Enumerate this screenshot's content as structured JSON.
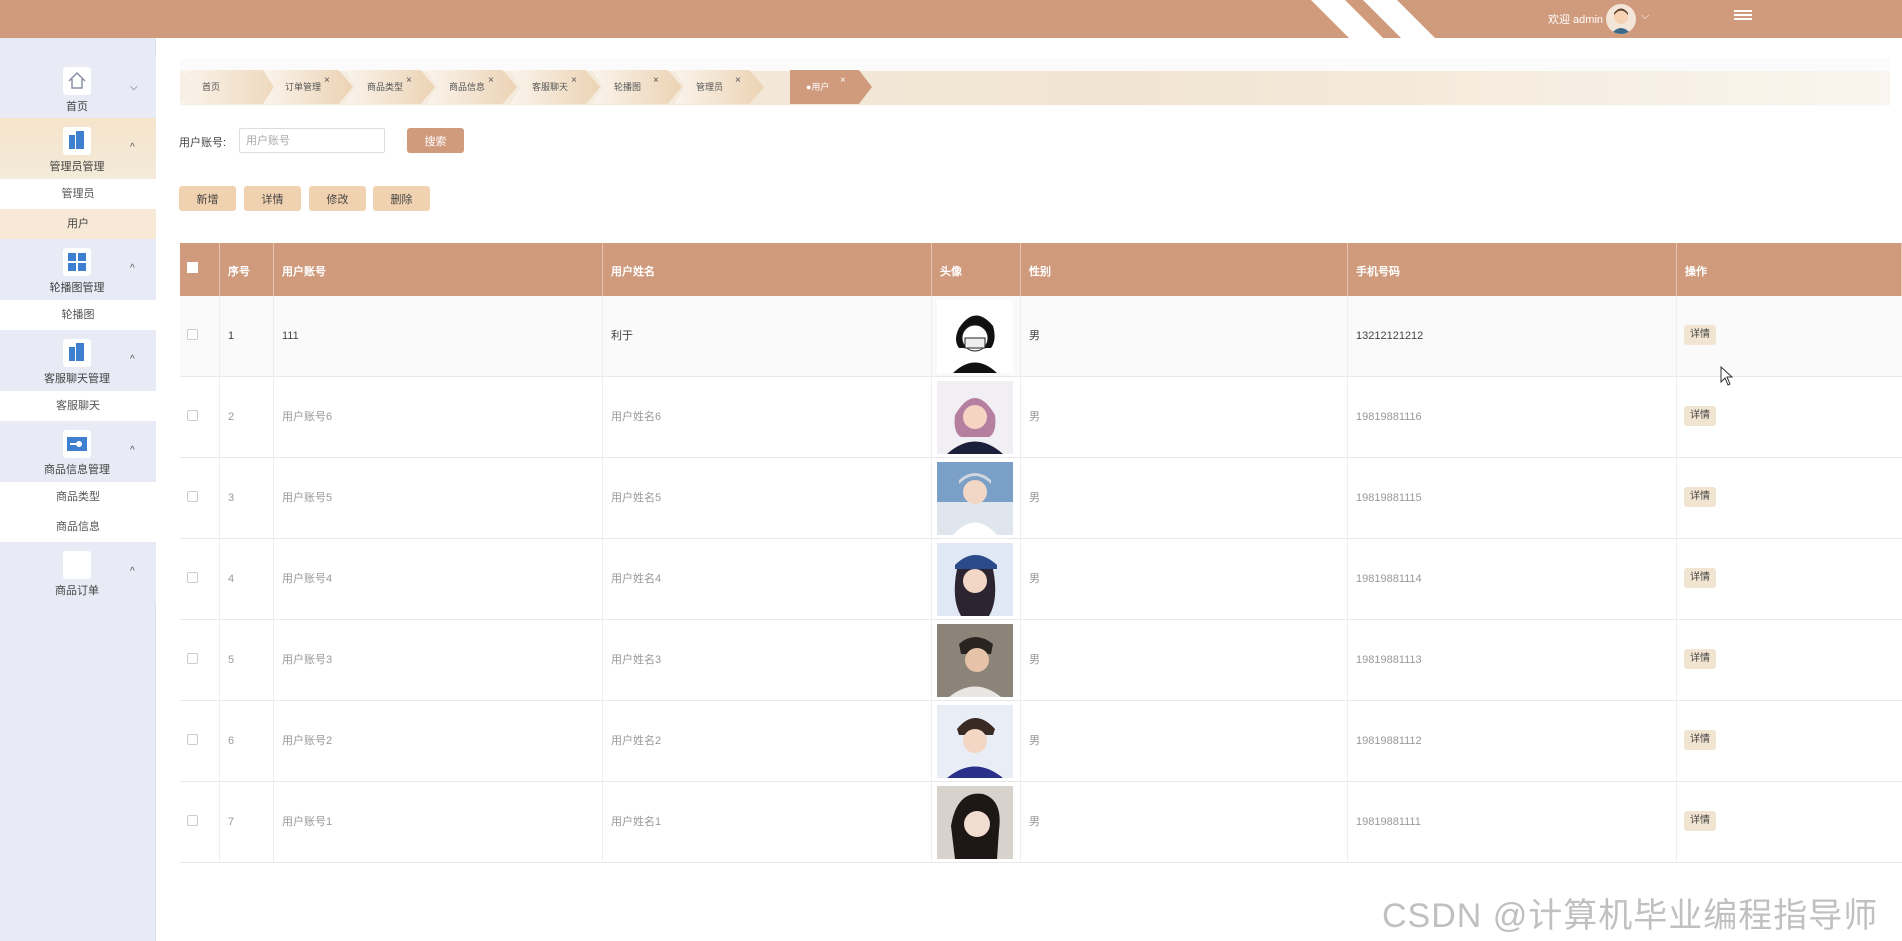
{
  "header": {
    "welcome": "欢迎 admin",
    "menu_icon": "hamburger-icon",
    "bg_color": "#d09a7c"
  },
  "sidebar": {
    "groups": [
      {
        "label": "首页",
        "icon": "home-icon",
        "expanded": false
      },
      {
        "label": "管理员管理",
        "icon": "building-icon",
        "expanded": true,
        "items": [
          "管理员",
          "用户"
        ]
      },
      {
        "label": "轮播图管理",
        "icon": "grid-icon",
        "expanded": true,
        "items": [
          "轮播图"
        ]
      },
      {
        "label": "客服聊天管理",
        "icon": "building-icon",
        "expanded": true,
        "items": [
          "客服聊天"
        ]
      },
      {
        "label": "商品信息管理",
        "icon": "toggle-icon",
        "expanded": true,
        "items": [
          "商品类型",
          "商品信息"
        ]
      },
      {
        "label": "商品订单",
        "icon": "blank-icon",
        "expanded": true
      }
    ],
    "active_item": "用户"
  },
  "tags": [
    {
      "label": "首页",
      "closable": false
    },
    {
      "label": "订单管理",
      "closable": true
    },
    {
      "label": "商品类型",
      "closable": true
    },
    {
      "label": "商品信息",
      "closable": true
    },
    {
      "label": "客服聊天",
      "closable": true
    },
    {
      "label": "轮播图",
      "closable": true
    },
    {
      "label": "管理员",
      "closable": true
    },
    {
      "label": "●用户",
      "closable": true,
      "active": true
    }
  ],
  "search": {
    "label": "用户账号:",
    "placeholder": "用户账号",
    "value": "",
    "button": "搜索"
  },
  "actions": {
    "add": "新增",
    "detail": "详情",
    "edit": "修改",
    "delete": "删除"
  },
  "table": {
    "columns": [
      "序号",
      "用户账号",
      "用户姓名",
      "头像",
      "性别",
      "手机号码",
      "操作"
    ],
    "rows": [
      {
        "no": "1",
        "account": "111",
        "name": "利于",
        "gender": "男",
        "phone": "13212121212",
        "op": "详情"
      },
      {
        "no": "2",
        "account": "用户账号6",
        "name": "用户姓名6",
        "gender": "男",
        "phone": "19819881116",
        "op": "详情"
      },
      {
        "no": "3",
        "account": "用户账号5",
        "name": "用户姓名5",
        "gender": "男",
        "phone": "19819881115",
        "op": "详情"
      },
      {
        "no": "4",
        "account": "用户账号4",
        "name": "用户姓名4",
        "gender": "男",
        "phone": "19819881114",
        "op": "详情"
      },
      {
        "no": "5",
        "account": "用户账号3",
        "name": "用户姓名3",
        "gender": "男",
        "phone": "19819881113",
        "op": "详情"
      },
      {
        "no": "6",
        "account": "用户账号2",
        "name": "用户姓名2",
        "gender": "男",
        "phone": "19819881112",
        "op": "详情"
      },
      {
        "no": "7",
        "account": "用户账号1",
        "name": "用户姓名1",
        "gender": "男",
        "phone": "19819881111",
        "op": "详情"
      }
    ]
  },
  "watermark": "CSDN @计算机毕业编程指导师"
}
